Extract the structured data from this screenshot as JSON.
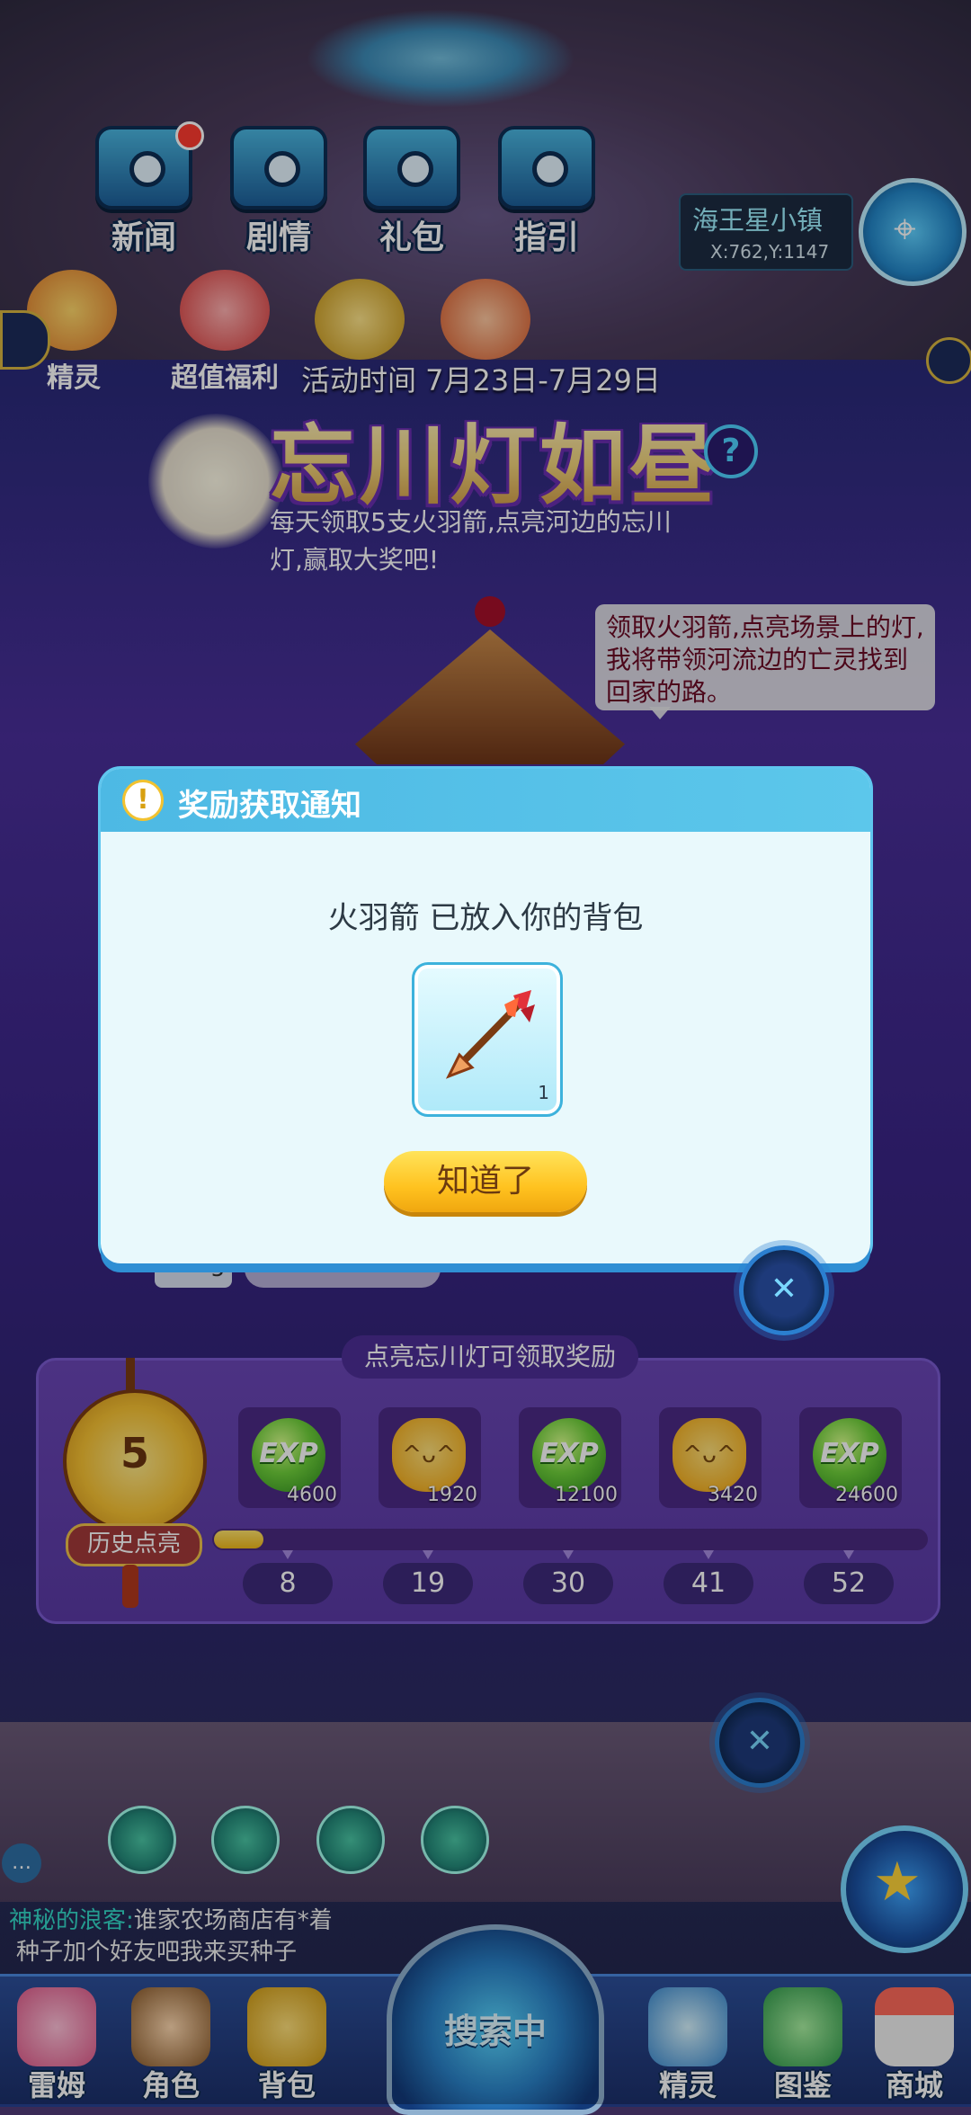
{
  "top_nav": [
    {
      "label": "新闻",
      "icon": "newspaper-icon"
    },
    {
      "label": "剧情",
      "icon": "story-icon"
    },
    {
      "label": "礼包",
      "icon": "gift-pack-icon"
    },
    {
      "label": "指引",
      "icon": "guide-icon"
    }
  ],
  "location": {
    "name": "海王星小镇",
    "coords": "X:762,Y:1147"
  },
  "side_left": [
    {
      "label": "精灵",
      "icon": "elf-icon"
    },
    {
      "label": "超值福利",
      "icon": "welfare-gift-icon"
    }
  ],
  "event": {
    "time": "活动时间 7月23日-7月29日",
    "title": "忘川灯如昼",
    "description": "每天领取5支火羽箭,点亮河边的忘川灯,赢取大奖吧!",
    "speech": "领取火羽箭,点亮场景上的灯,我将带领河流边的亡灵找到回家的路。"
  },
  "modal": {
    "title": "奖励获取通知",
    "message": "火羽箭 已放入你的背包",
    "item_name": "火羽箭",
    "item_qty": "1",
    "confirm": "知道了"
  },
  "hidden_count": "5",
  "rewards": {
    "title": "点亮忘川灯可领取奖励",
    "lit_count": "5",
    "lit_label": "历史点亮",
    "items": [
      {
        "type": "EXP",
        "amount": "4600"
      },
      {
        "type": "cat",
        "amount": "1920"
      },
      {
        "type": "EXP",
        "amount": "12100"
      },
      {
        "type": "cat",
        "amount": "3420"
      },
      {
        "type": "EXP",
        "amount": "24600"
      }
    ],
    "milestones": [
      "8",
      "19",
      "30",
      "41",
      "52"
    ],
    "progress_fraction": 0.07
  },
  "chat": {
    "name": "神秘的浪客:",
    "text": "谁家农场商店有*着",
    "line2": "种子加个好友吧我来买种子"
  },
  "radar": {
    "label": "搜索中"
  },
  "bottom_nav": [
    {
      "label": "雷姆",
      "icon": "leimu-pet-icon"
    },
    {
      "label": "角色",
      "icon": "character-icon"
    },
    {
      "label": "背包",
      "icon": "backpack-icon"
    },
    {
      "label": "精灵",
      "icon": "elf-icon"
    },
    {
      "label": "图鉴",
      "icon": "handbook-icon"
    },
    {
      "label": "商城",
      "icon": "shop-icon"
    }
  ],
  "colors": {
    "accent": "#5cc7eb",
    "button": "#ffc21f",
    "panel": "#5a3aa5"
  }
}
